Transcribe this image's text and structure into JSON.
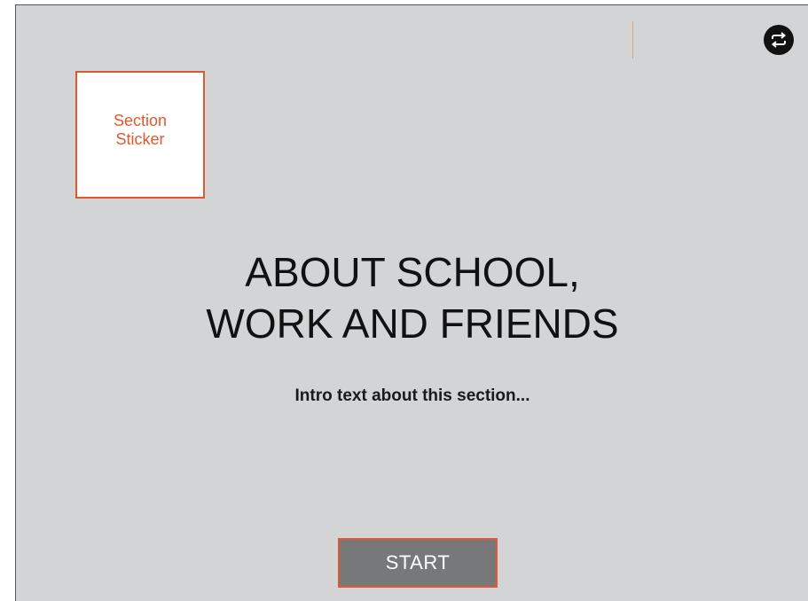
{
  "header": {
    "switch_icon": "repeat-arrows-icon"
  },
  "sticker": {
    "label": "Section\nSticker"
  },
  "main": {
    "title": "ABOUT SCHOOL,\nWORK AND FRIENDS",
    "intro": "Intro text about this section..."
  },
  "footer": {
    "start_label": "START"
  },
  "colors": {
    "accent": "#e1572f",
    "background": "#d3d4d6",
    "button": "#77787a"
  }
}
